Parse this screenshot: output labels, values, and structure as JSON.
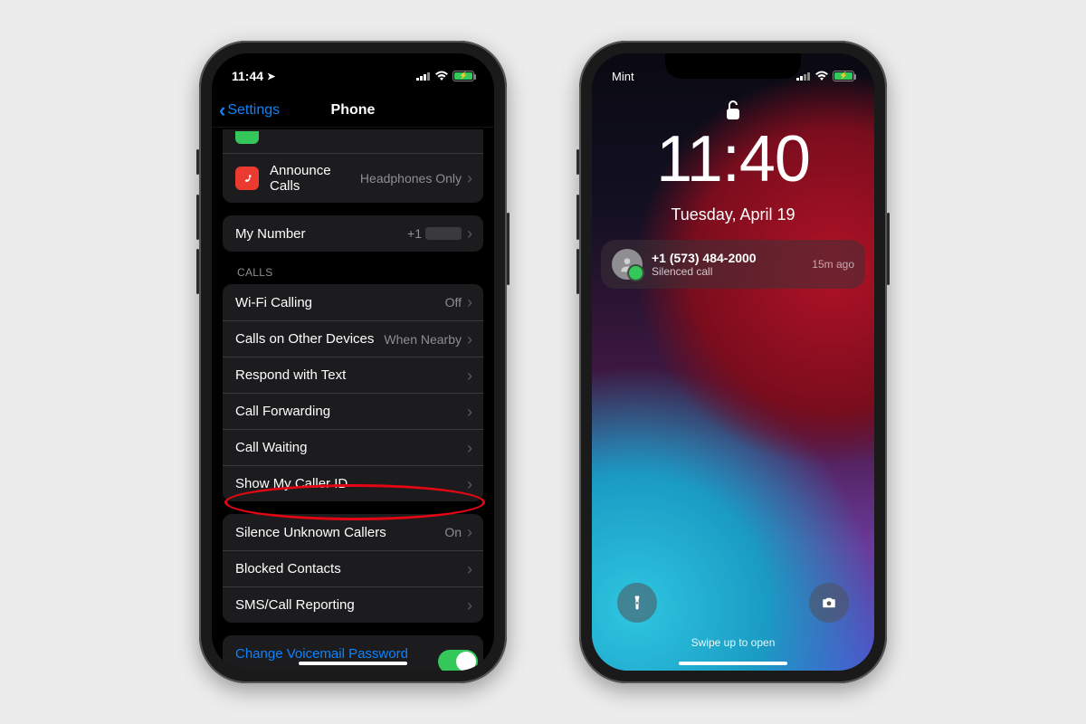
{
  "left_phone": {
    "status": {
      "time": "11:44",
      "location_icon": "location-arrow"
    },
    "nav": {
      "back_label": "Settings",
      "title": "Phone"
    },
    "row_announce": {
      "label": "Announce Calls",
      "value": "Headphones Only"
    },
    "row_my_number": {
      "label": "My Number",
      "value_prefix": "+1"
    },
    "section_calls_header": "CALLS",
    "calls": {
      "wifi_calling": {
        "label": "Wi-Fi Calling",
        "value": "Off"
      },
      "other_devices": {
        "label": "Calls on Other Devices",
        "value": "When Nearby"
      },
      "respond_text": {
        "label": "Respond with Text"
      },
      "call_forwarding": {
        "label": "Call Forwarding"
      },
      "call_waiting": {
        "label": "Call Waiting"
      },
      "show_caller_id": {
        "label": "Show My Caller ID"
      }
    },
    "section_silence": {
      "silence_unknown": {
        "label": "Silence Unknown Callers",
        "value": "On"
      },
      "blocked": {
        "label": "Blocked Contacts"
      },
      "sms_report": {
        "label": "SMS/Call Reporting"
      }
    },
    "voicemail": {
      "label": "Change Voicemail Password"
    },
    "highlight": "Silence Unknown Callers"
  },
  "right_phone": {
    "status": {
      "carrier": "Mint"
    },
    "lock": {
      "time": "11:40",
      "date": "Tuesday, April 19",
      "swipe_hint": "Swipe up to open"
    },
    "notification": {
      "number": "+1 (573) 484-2000",
      "subtitle": "Silenced call",
      "age": "15m ago"
    }
  }
}
